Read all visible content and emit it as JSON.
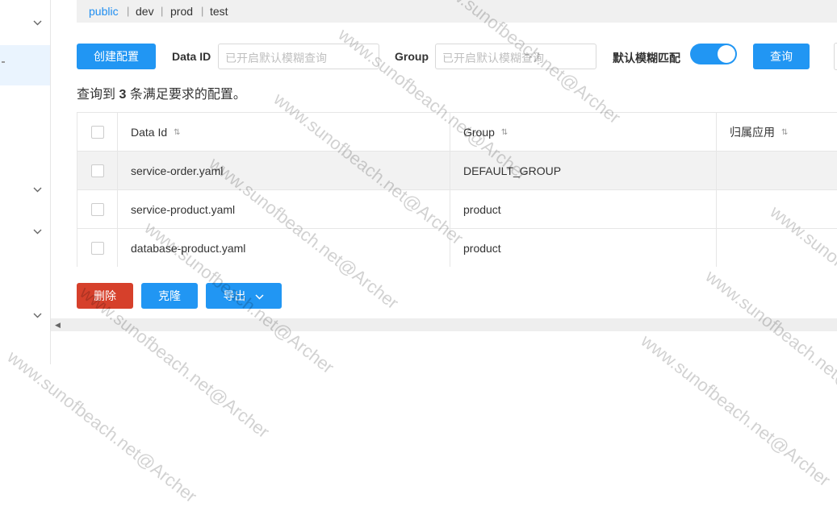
{
  "namespaces": [
    "public",
    "dev",
    "prod",
    "test"
  ],
  "toolbar": {
    "create_label": "创建配置",
    "dataid_label": "Data ID",
    "dataid_placeholder": "已开启默认模糊查询",
    "group_label": "Group",
    "group_placeholder": "已开启默认模糊查询",
    "fuzzy_label": "默认模糊匹配",
    "fuzzy_on": true,
    "query_label": "查询"
  },
  "result": {
    "prefix": "查询到",
    "count": "3",
    "suffix": "条满足要求的配置。"
  },
  "table": {
    "headers": [
      "Data Id",
      "Group",
      "归属应用"
    ],
    "rows": [
      {
        "data_id": "service-order.yaml",
        "group": "DEFAULT_GROUP",
        "app": ""
      },
      {
        "data_id": "service-product.yaml",
        "group": "product",
        "app": ""
      },
      {
        "data_id": "database-product.yaml",
        "group": "product",
        "app": ""
      }
    ]
  },
  "actions": {
    "delete_label": "删除",
    "clone_label": "克隆",
    "export_label": "导出"
  },
  "watermark": "www.sunofbeach.net@Archer",
  "colors": {
    "primary": "#2196f3",
    "danger": "#d6402b",
    "link": "#1f8ef1"
  }
}
